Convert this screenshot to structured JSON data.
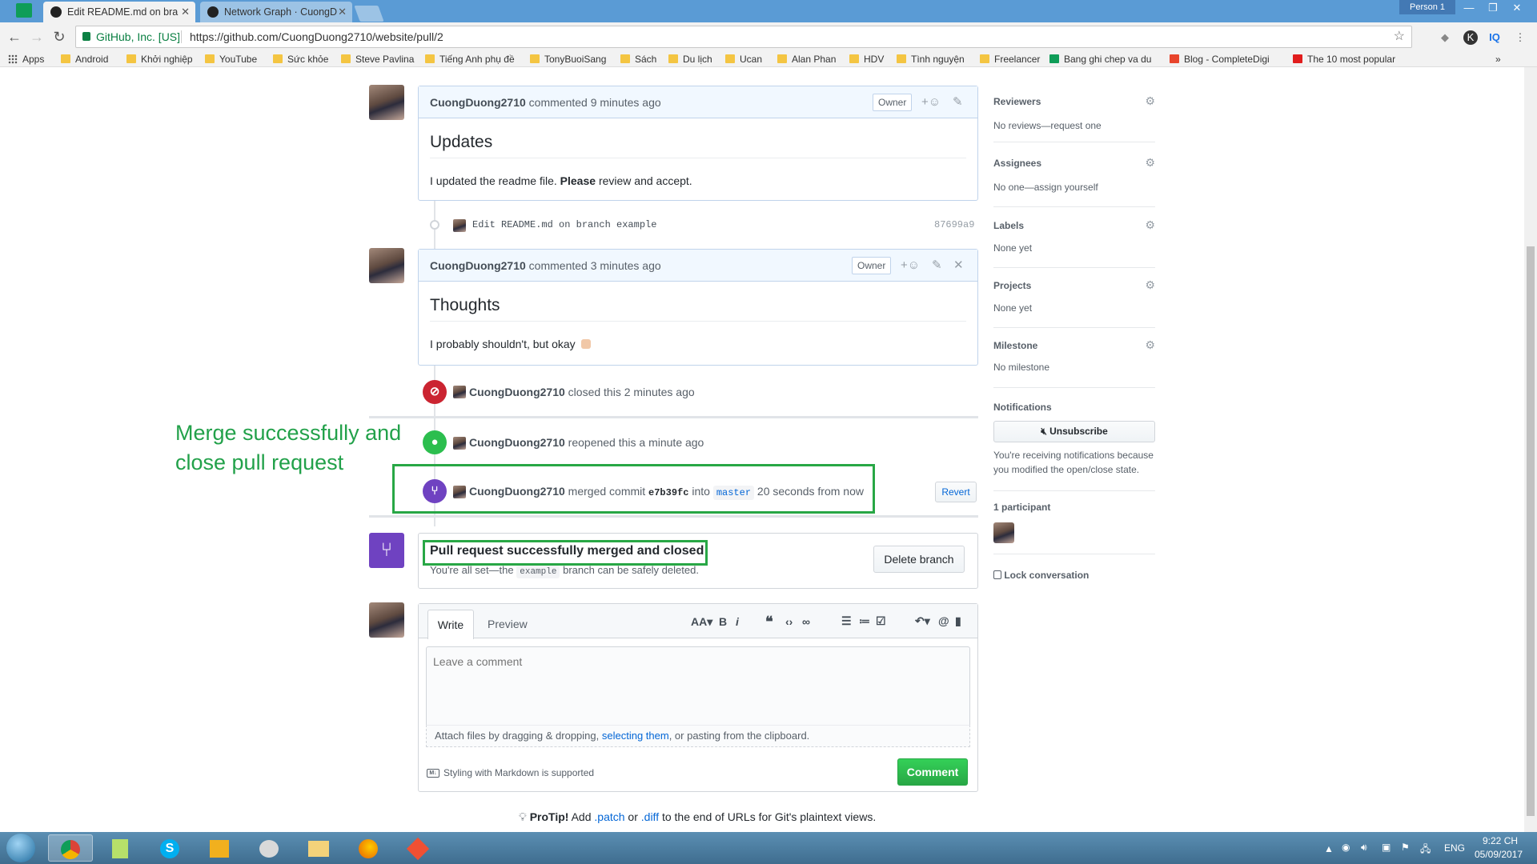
{
  "browser": {
    "tabs": [
      {
        "title": "Edit README.md on bra"
      },
      {
        "title": "Network Graph · CuongD"
      }
    ],
    "person": "Person 1",
    "secure_label": "GitHub, Inc. [US]",
    "url": "https://github.com/CuongDuong2710/website/pull/2",
    "bookmarks": [
      "Apps",
      "Android",
      "Khởi nghiệp",
      "YouTube",
      "Sức khỏe",
      "Steve Pavlina",
      "Tiếng Anh phụ đề",
      "TonyBuoiSang",
      "Sách",
      "Du lịch",
      "Ucan",
      "Alan Phan",
      "HDV",
      "Tình nguyện",
      "Freelancer",
      "Bang ghi chep va du",
      "Blog - CompleteDigi",
      "The 10 most popular"
    ]
  },
  "timeline": {
    "comment1": {
      "author": "CuongDuong2710",
      "action": "commented",
      "time": "9 minutes ago",
      "role": "Owner",
      "heading": "Updates",
      "body_text": "I updated the readme file.",
      "body_bold": "Please",
      "body_rest": "review and accept."
    },
    "commit": {
      "message": "Edit README.md on branch example",
      "sha": "87699a9"
    },
    "comment2": {
      "author": "CuongDuong2710",
      "action": "commented",
      "time": "3 minutes ago",
      "role": "Owner",
      "heading": "Thoughts",
      "body_text": "I probably shouldn't, but okay"
    },
    "closed_event": {
      "author": "CuongDuong2710",
      "text": "closed this 2 minutes ago"
    },
    "reopened_event": {
      "author": "CuongDuong2710",
      "text": "reopened this a minute ago"
    },
    "merged_event": {
      "author": "CuongDuong2710",
      "prefix": "merged commit",
      "commit": "e7b39fc",
      "into": "into",
      "branch": "master",
      "time": "20 seconds from now",
      "revert_label": "Revert"
    },
    "merged_box": {
      "title": "Pull request successfully merged and closed",
      "sub_prefix": "You're all set—the",
      "branch": "example",
      "sub_suffix": "branch can be safely deleted.",
      "delete_label": "Delete branch"
    }
  },
  "annotation": {
    "line1": "Merge successfully and",
    "line2": "close pull request",
    "color": "#22a14a"
  },
  "editor": {
    "tab_write": "Write",
    "tab_preview": "Preview",
    "placeholder": "Leave a comment",
    "attach_prefix": "Attach files by dragging & dropping,",
    "attach_link": "selecting them",
    "attach_suffix": ", or pasting from the clipboard.",
    "markdown_note": "Styling with Markdown is supported",
    "comment_button": "Comment"
  },
  "protip": {
    "label": "ProTip!",
    "text1": "Add",
    "patch": ".patch",
    "or": "or",
    "diff": ".diff",
    "text2": "to the end of URLs for Git's plaintext views."
  },
  "sidebar": {
    "reviewers": {
      "title": "Reviewers",
      "value": "No reviews—request one"
    },
    "assignees": {
      "title": "Assignees",
      "value": "No one—assign yourself"
    },
    "labels": {
      "title": "Labels",
      "value": "None yet"
    },
    "projects": {
      "title": "Projects",
      "value": "None yet"
    },
    "milestone": {
      "title": "Milestone",
      "value": "No milestone"
    },
    "notifications": {
      "title": "Notifications",
      "button": "Unsubscribe",
      "note": "You're receiving notifications because you modified the open/close state."
    },
    "participants": {
      "title": "1 participant"
    },
    "lock": "Lock conversation"
  },
  "taskbar": {
    "language": "ENG",
    "time": "9:22 CH",
    "date": "05/09/2017"
  },
  "colors": {
    "closed": "#cb2431",
    "reopened": "#2cbe4e",
    "merged": "#6f42c1",
    "link": "#0366d6",
    "tab_bar": "#5a9bd5"
  }
}
